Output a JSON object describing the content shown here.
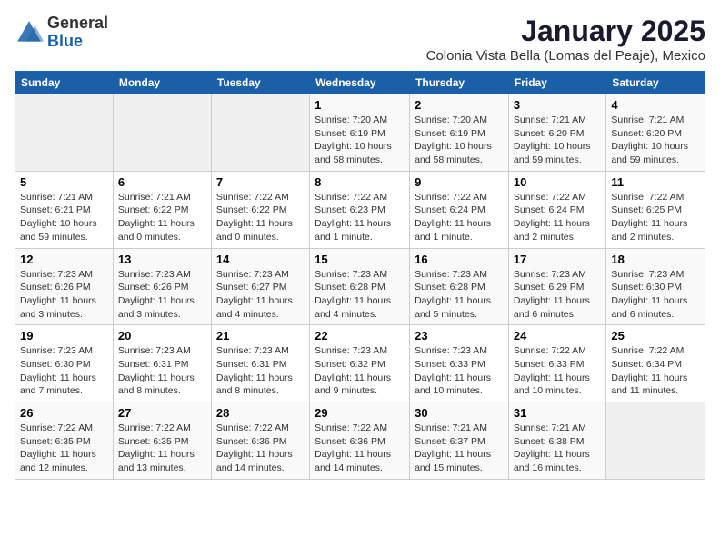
{
  "logo": {
    "general": "General",
    "blue": "Blue"
  },
  "header": {
    "title": "January 2025",
    "subtitle": "Colonia Vista Bella (Lomas del Peaje), Mexico"
  },
  "weekdays": [
    "Sunday",
    "Monday",
    "Tuesday",
    "Wednesday",
    "Thursday",
    "Friday",
    "Saturday"
  ],
  "weeks": [
    [
      {
        "day": "",
        "info": ""
      },
      {
        "day": "",
        "info": ""
      },
      {
        "day": "",
        "info": ""
      },
      {
        "day": "1",
        "info": "Sunrise: 7:20 AM\nSunset: 6:19 PM\nDaylight: 10 hours\nand 58 minutes."
      },
      {
        "day": "2",
        "info": "Sunrise: 7:20 AM\nSunset: 6:19 PM\nDaylight: 10 hours\nand 58 minutes."
      },
      {
        "day": "3",
        "info": "Sunrise: 7:21 AM\nSunset: 6:20 PM\nDaylight: 10 hours\nand 59 minutes."
      },
      {
        "day": "4",
        "info": "Sunrise: 7:21 AM\nSunset: 6:20 PM\nDaylight: 10 hours\nand 59 minutes."
      }
    ],
    [
      {
        "day": "5",
        "info": "Sunrise: 7:21 AM\nSunset: 6:21 PM\nDaylight: 10 hours\nand 59 minutes."
      },
      {
        "day": "6",
        "info": "Sunrise: 7:21 AM\nSunset: 6:22 PM\nDaylight: 11 hours\nand 0 minutes."
      },
      {
        "day": "7",
        "info": "Sunrise: 7:22 AM\nSunset: 6:22 PM\nDaylight: 11 hours\nand 0 minutes."
      },
      {
        "day": "8",
        "info": "Sunrise: 7:22 AM\nSunset: 6:23 PM\nDaylight: 11 hours\nand 1 minute."
      },
      {
        "day": "9",
        "info": "Sunrise: 7:22 AM\nSunset: 6:24 PM\nDaylight: 11 hours\nand 1 minute."
      },
      {
        "day": "10",
        "info": "Sunrise: 7:22 AM\nSunset: 6:24 PM\nDaylight: 11 hours\nand 2 minutes."
      },
      {
        "day": "11",
        "info": "Sunrise: 7:22 AM\nSunset: 6:25 PM\nDaylight: 11 hours\nand 2 minutes."
      }
    ],
    [
      {
        "day": "12",
        "info": "Sunrise: 7:23 AM\nSunset: 6:26 PM\nDaylight: 11 hours\nand 3 minutes."
      },
      {
        "day": "13",
        "info": "Sunrise: 7:23 AM\nSunset: 6:26 PM\nDaylight: 11 hours\nand 3 minutes."
      },
      {
        "day": "14",
        "info": "Sunrise: 7:23 AM\nSunset: 6:27 PM\nDaylight: 11 hours\nand 4 minutes."
      },
      {
        "day": "15",
        "info": "Sunrise: 7:23 AM\nSunset: 6:28 PM\nDaylight: 11 hours\nand 4 minutes."
      },
      {
        "day": "16",
        "info": "Sunrise: 7:23 AM\nSunset: 6:28 PM\nDaylight: 11 hours\nand 5 minutes."
      },
      {
        "day": "17",
        "info": "Sunrise: 7:23 AM\nSunset: 6:29 PM\nDaylight: 11 hours\nand 6 minutes."
      },
      {
        "day": "18",
        "info": "Sunrise: 7:23 AM\nSunset: 6:30 PM\nDaylight: 11 hours\nand 6 minutes."
      }
    ],
    [
      {
        "day": "19",
        "info": "Sunrise: 7:23 AM\nSunset: 6:30 PM\nDaylight: 11 hours\nand 7 minutes."
      },
      {
        "day": "20",
        "info": "Sunrise: 7:23 AM\nSunset: 6:31 PM\nDaylight: 11 hours\nand 8 minutes."
      },
      {
        "day": "21",
        "info": "Sunrise: 7:23 AM\nSunset: 6:31 PM\nDaylight: 11 hours\nand 8 minutes."
      },
      {
        "day": "22",
        "info": "Sunrise: 7:23 AM\nSunset: 6:32 PM\nDaylight: 11 hours\nand 9 minutes."
      },
      {
        "day": "23",
        "info": "Sunrise: 7:23 AM\nSunset: 6:33 PM\nDaylight: 11 hours\nand 10 minutes."
      },
      {
        "day": "24",
        "info": "Sunrise: 7:22 AM\nSunset: 6:33 PM\nDaylight: 11 hours\nand 10 minutes."
      },
      {
        "day": "25",
        "info": "Sunrise: 7:22 AM\nSunset: 6:34 PM\nDaylight: 11 hours\nand 11 minutes."
      }
    ],
    [
      {
        "day": "26",
        "info": "Sunrise: 7:22 AM\nSunset: 6:35 PM\nDaylight: 11 hours\nand 12 minutes."
      },
      {
        "day": "27",
        "info": "Sunrise: 7:22 AM\nSunset: 6:35 PM\nDaylight: 11 hours\nand 13 minutes."
      },
      {
        "day": "28",
        "info": "Sunrise: 7:22 AM\nSunset: 6:36 PM\nDaylight: 11 hours\nand 14 minutes."
      },
      {
        "day": "29",
        "info": "Sunrise: 7:22 AM\nSunset: 6:36 PM\nDaylight: 11 hours\nand 14 minutes."
      },
      {
        "day": "30",
        "info": "Sunrise: 7:21 AM\nSunset: 6:37 PM\nDaylight: 11 hours\nand 15 minutes."
      },
      {
        "day": "31",
        "info": "Sunrise: 7:21 AM\nSunset: 6:38 PM\nDaylight: 11 hours\nand 16 minutes."
      },
      {
        "day": "",
        "info": ""
      }
    ]
  ]
}
